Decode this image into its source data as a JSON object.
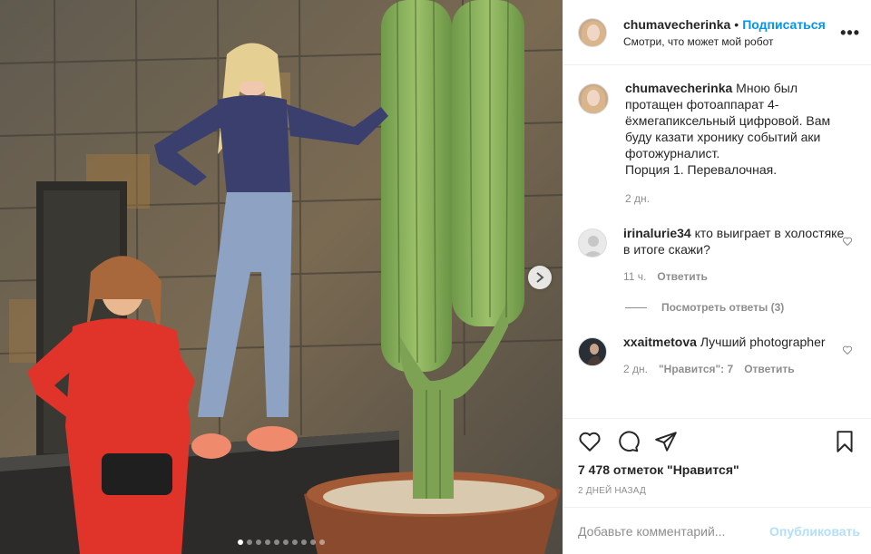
{
  "post": {
    "username": "chumavecherinka",
    "follow_label": "Подписаться",
    "separator": "•",
    "location": "Смотри, что может мой робот",
    "more_label": "•••"
  },
  "caption": {
    "username": "chumavecherinka",
    "text": " Мною был протащен фотоаппарат 4-ёхмегапиксельный цифровой. Вам буду казати хронику событий аки фотожурналист.",
    "text2": "Порция 1. Перевалочная.",
    "time": "2 дн."
  },
  "comments": [
    {
      "username": "irinalurie34",
      "text": " кто выиграет в холостяке в итоге скажи?",
      "time": "11 ч.",
      "reply_label": "Ответить"
    },
    {
      "username": "xxaitmetova",
      "text": " Лучший photographer",
      "time": "2 дн.",
      "likes_label": "\"Нравится\": 7",
      "reply_label": "Ответить"
    }
  ],
  "view_replies_label": "Посмотреть ответы (3)",
  "likes_text": "7 478 отметок \"Нравится\"",
  "date_text": "2 ДНЕЙ НАЗАД",
  "comment_input": {
    "placeholder": "Добавьте комментарий...",
    "value": ""
  },
  "publish_label": "Опубликовать",
  "carousel": {
    "total": 10,
    "active_index": 0
  },
  "icons": [
    "heart-icon",
    "comment-icon",
    "share-icon",
    "bookmark-icon",
    "chevron-right-icon",
    "more-icon",
    "small-heart-icon"
  ],
  "colors": {
    "link_blue": "#0095f6",
    "publish_disabled": "#b2dffc",
    "muted": "#8e8e8e"
  }
}
